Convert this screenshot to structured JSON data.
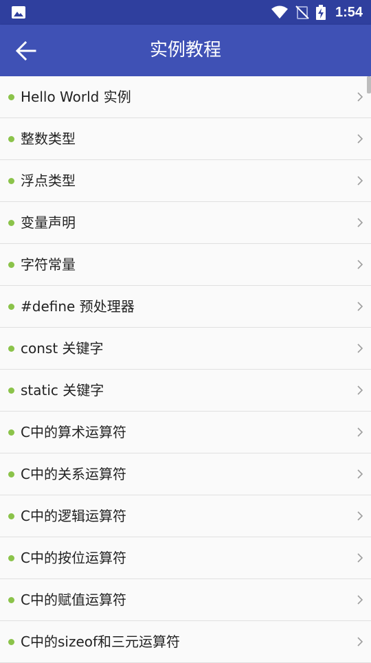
{
  "status_bar": {
    "time": "1:54"
  },
  "app_bar": {
    "title": "实例教程"
  },
  "list": {
    "items": [
      "Hello World 实例",
      "整数类型",
      "浮点类型",
      "变量声明",
      "字符常量",
      "#define 预处理器",
      "const 关键字",
      "static 关键字",
      "C中的算术运算符",
      "C中的关系运算符",
      "C中的逻辑运算符",
      "C中的按位运算符",
      "C中的赋值运算符",
      "C中的sizeof和三元运算符"
    ]
  },
  "colors": {
    "primary": "#3f51b5",
    "status_bar": "#2f3f9e",
    "bullet": "#8bc34a"
  }
}
